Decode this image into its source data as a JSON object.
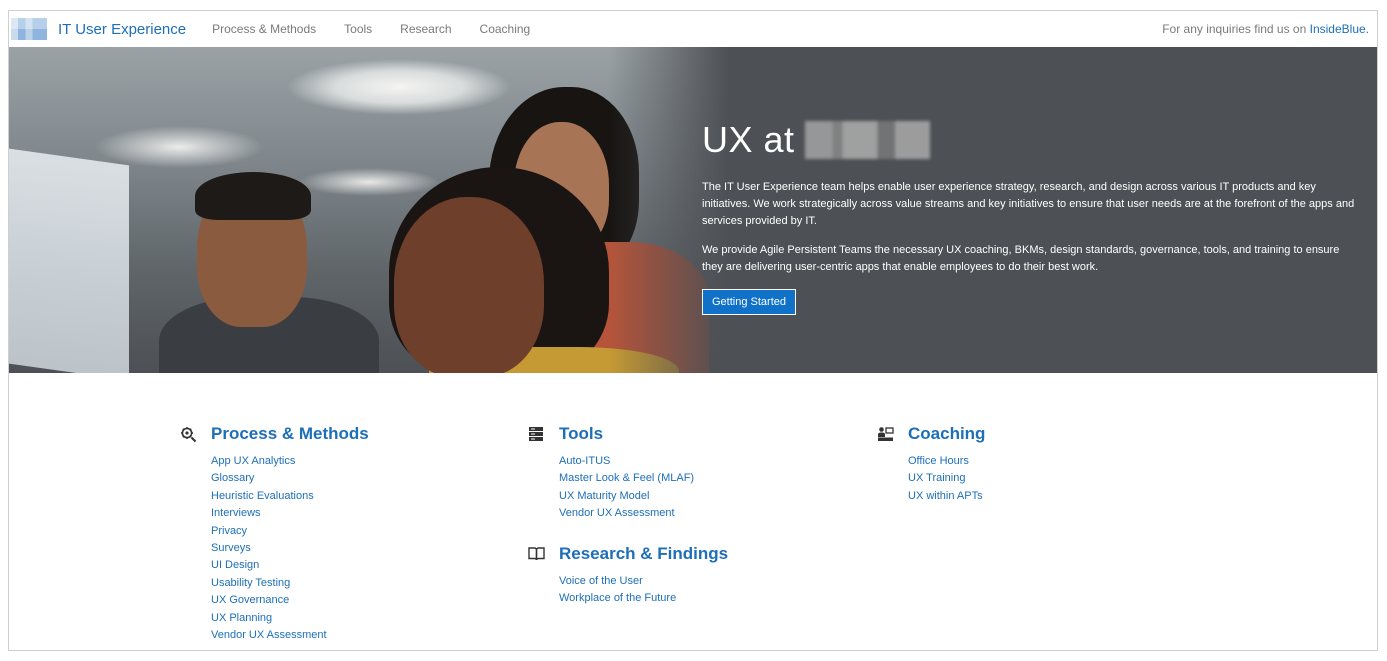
{
  "header": {
    "brand": "IT User Experience",
    "nav": [
      "Process & Methods",
      "Tools",
      "Research",
      "Coaching"
    ],
    "inquiry_prefix": "For any inquiries find us on ",
    "inquiry_link": "InsideBlue."
  },
  "hero": {
    "title": "UX at",
    "paragraph1": "The IT User Experience team helps enable user experience strategy, research, and design across various IT products and key initiatives. We work strategically across value streams and key initiatives to ensure that user needs are at the forefront of the apps and services provided by IT.",
    "paragraph2": "We provide Agile Persistent Teams the necessary UX coaching, BKMs, design standards, governance, tools, and training to ensure they are delivering user-centric apps that enable employees to do their best work.",
    "cta": "Getting Started"
  },
  "sections": {
    "process": {
      "title": "Process & Methods",
      "icon": "process-icon",
      "links": [
        "App UX Analytics",
        "Glossary",
        "Heuristic Evaluations",
        "Interviews",
        "Privacy",
        "Surveys",
        "UI Design",
        "Usability Testing",
        "UX Governance",
        "UX Planning",
        "Vendor UX Assessment"
      ]
    },
    "tools": {
      "title": "Tools",
      "icon": "tools-icon",
      "links": [
        "Auto-ITUS",
        "Master Look & Feel (MLAF)",
        "UX Maturity Model",
        "Vendor UX Assessment"
      ]
    },
    "research": {
      "title": "Research & Findings",
      "icon": "book-icon",
      "links": [
        "Voice of the User",
        "Workplace of the Future"
      ]
    },
    "coaching": {
      "title": "Coaching",
      "icon": "coaching-icon",
      "links": [
        "Office Hours",
        "UX Training",
        "UX within APTs"
      ]
    }
  },
  "colors": {
    "accent": "#1d6fb8",
    "button": "#0f71c7",
    "hero_bg": "#4d5054"
  }
}
